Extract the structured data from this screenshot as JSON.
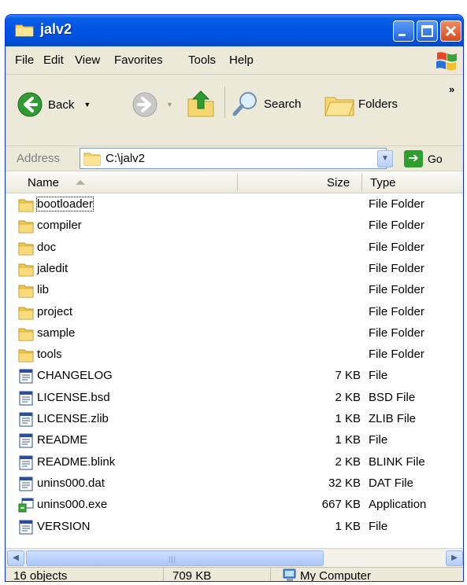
{
  "window": {
    "title": "jalv2"
  },
  "menu": {
    "file": "File",
    "edit": "Edit",
    "view": "View",
    "favorites": "Favorites",
    "tools": "Tools",
    "help": "Help"
  },
  "toolbar": {
    "back": "Back",
    "search": "Search",
    "folders": "Folders",
    "more": "»"
  },
  "address": {
    "label": "Address",
    "value": "C:\\jalv2",
    "go": "Go"
  },
  "columns": {
    "name": "Name",
    "size": "Size",
    "type": "Type"
  },
  "rows": [
    {
      "name": "bootloader",
      "size": "",
      "type": "File Folder",
      "icon": "folder-icon"
    },
    {
      "name": "compiler",
      "size": "",
      "type": "File Folder",
      "icon": "folder-icon"
    },
    {
      "name": "doc",
      "size": "",
      "type": "File Folder",
      "icon": "folder-icon"
    },
    {
      "name": "jaledit",
      "size": "",
      "type": "File Folder",
      "icon": "folder-icon"
    },
    {
      "name": "lib",
      "size": "",
      "type": "File Folder",
      "icon": "folder-icon"
    },
    {
      "name": "project",
      "size": "",
      "type": "File Folder",
      "icon": "folder-icon"
    },
    {
      "name": "sample",
      "size": "",
      "type": "File Folder",
      "icon": "folder-icon"
    },
    {
      "name": "tools",
      "size": "",
      "type": "File Folder",
      "icon": "folder-icon"
    },
    {
      "name": "CHANGELOG",
      "size": "7 KB",
      "type": "File",
      "icon": "document-icon"
    },
    {
      "name": "LICENSE.bsd",
      "size": "2 KB",
      "type": "BSD File",
      "icon": "document-icon"
    },
    {
      "name": "LICENSE.zlib",
      "size": "1 KB",
      "type": "ZLIB File",
      "icon": "document-icon"
    },
    {
      "name": "README",
      "size": "1 KB",
      "type": "File",
      "icon": "document-icon"
    },
    {
      "name": "README.blink",
      "size": "2 KB",
      "type": "BLINK File",
      "icon": "document-icon"
    },
    {
      "name": "unins000.dat",
      "size": "32 KB",
      "type": "DAT File",
      "icon": "document-icon"
    },
    {
      "name": "unins000.exe",
      "size": "667 KB",
      "type": "Application",
      "icon": "application-icon"
    },
    {
      "name": "VERSION",
      "size": "1 KB",
      "type": "File",
      "icon": "document-icon"
    }
  ],
  "status": {
    "objects": "16 objects",
    "total_size": "709 KB",
    "location": "My Computer"
  },
  "colors": {
    "titlebar": "#0054e3",
    "chrome": "#ece9d8",
    "folder": "#f2c94c"
  }
}
